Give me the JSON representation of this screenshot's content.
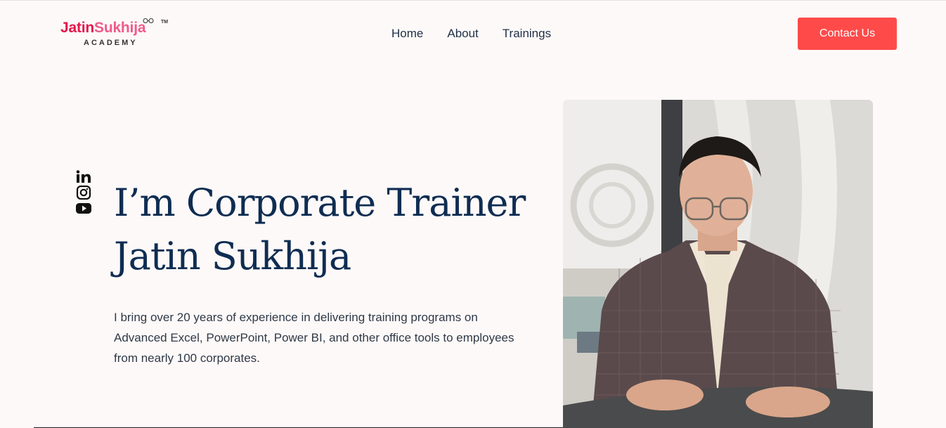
{
  "header": {
    "logo": {
      "brand_part1": "Jatin",
      "brand_part2": "Sukhija",
      "trademark": "TM",
      "subtitle": "ACADEMY"
    },
    "nav": [
      {
        "label": "Home"
      },
      {
        "label": "About"
      },
      {
        "label": "Trainings"
      }
    ],
    "cta_label": "Contact Us"
  },
  "social": [
    {
      "icon": "linkedin-icon"
    },
    {
      "icon": "instagram-icon"
    },
    {
      "icon": "youtube-icon"
    }
  ],
  "hero": {
    "title_line1": "I’m Corporate Trainer",
    "title_line2": "Jatin Sukhija",
    "description": "I bring over 20 years of experience in delivering training programs on Advanced Excel, PowerPoint, Power BI, and other office tools to employees from nearly 100 corporates."
  },
  "colors": {
    "background": "#fdf9f8",
    "heading": "#0f2d52",
    "accent": "#ff4a4a",
    "logo_primary": "#e2174a"
  }
}
